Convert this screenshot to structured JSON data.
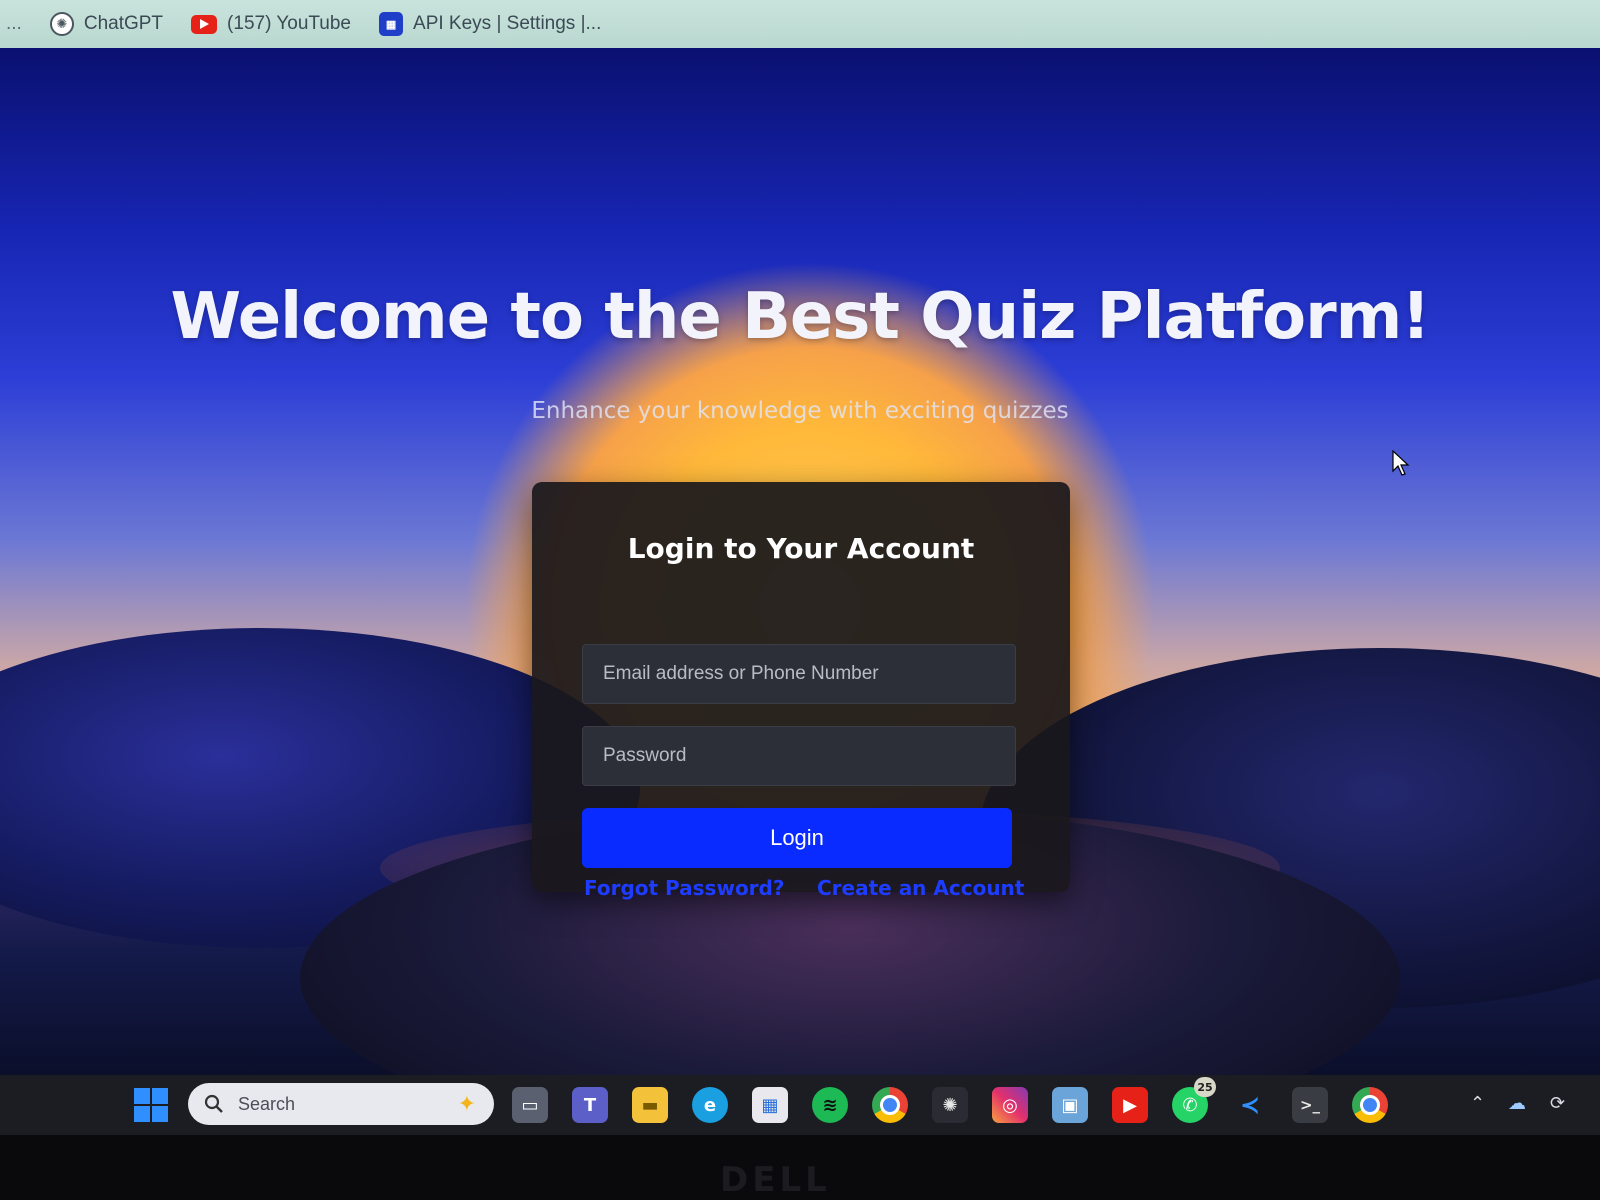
{
  "bookmarks": {
    "more": "...",
    "items": [
      {
        "label": "ChatGPT",
        "icon": "chatgpt-icon"
      },
      {
        "label": "(157) YouTube",
        "icon": "youtube-icon"
      },
      {
        "label": "API Keys | Settings |...",
        "icon": "api-keys-icon"
      }
    ]
  },
  "hero": {
    "title": "Welcome to the Best Quiz Platform!",
    "subtitle": "Enhance your knowledge with exciting quizzes"
  },
  "login": {
    "title": "Login to Your Account",
    "email_placeholder": "Email address or Phone Number",
    "password_placeholder": "Password",
    "button_label": "Login",
    "forgot_label": "Forgot Password?",
    "create_label": "Create an Account",
    "button_color": "#0a2bff",
    "link_color": "#1e3cff"
  },
  "taskbar": {
    "search_placeholder": "Search",
    "whatsapp_badge": "25",
    "apps": [
      "task-view-icon",
      "teams-icon",
      "file-explorer-icon",
      "edge-icon",
      "store-icon",
      "spotify-icon",
      "chrome-icon",
      "chatgpt-app-icon",
      "instagram-icon",
      "photos-icon",
      "youtube-app-icon",
      "whatsapp-icon",
      "vscode-icon",
      "terminal-icon",
      "chrome-profile-icon"
    ]
  },
  "bezel": {
    "brand": "DELL"
  }
}
